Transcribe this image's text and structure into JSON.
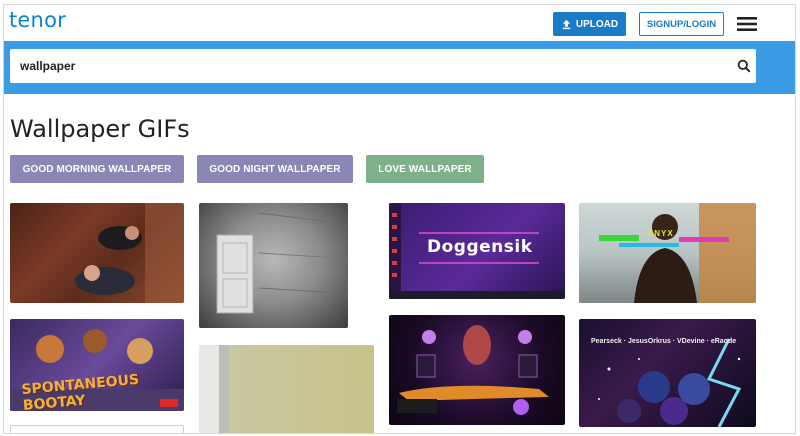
{
  "header": {
    "logo": "tenor",
    "upload_label": "UPLOAD",
    "signup_label": "SIGNUP/LOGIN"
  },
  "search": {
    "value": "wallpaper"
  },
  "main": {
    "title": "Wallpaper GIFs",
    "chips": [
      {
        "label": "GOOD MORNING WALLPAPER",
        "color": "#8a86b5"
      },
      {
        "label": "GOOD NIGHT WALLPAPER",
        "color": "#8a86b5"
      },
      {
        "label": "LOVE WALLPAPER",
        "color": "#7eb089"
      }
    ],
    "gif_captions": {
      "doggensik": "Doggensik",
      "onyx": "ONYX",
      "booty": "SPONTANEOUS BOOTAY",
      "names": "Pearseck · JesusOrkrus · VDevine · eRaode"
    }
  },
  "colors": {
    "brand": "#0f83c9",
    "upload_bg": "#1a7bc7",
    "search_band": "#3b9be4"
  },
  "icons": [
    "upload-icon",
    "menu-icon",
    "search-icon"
  ]
}
